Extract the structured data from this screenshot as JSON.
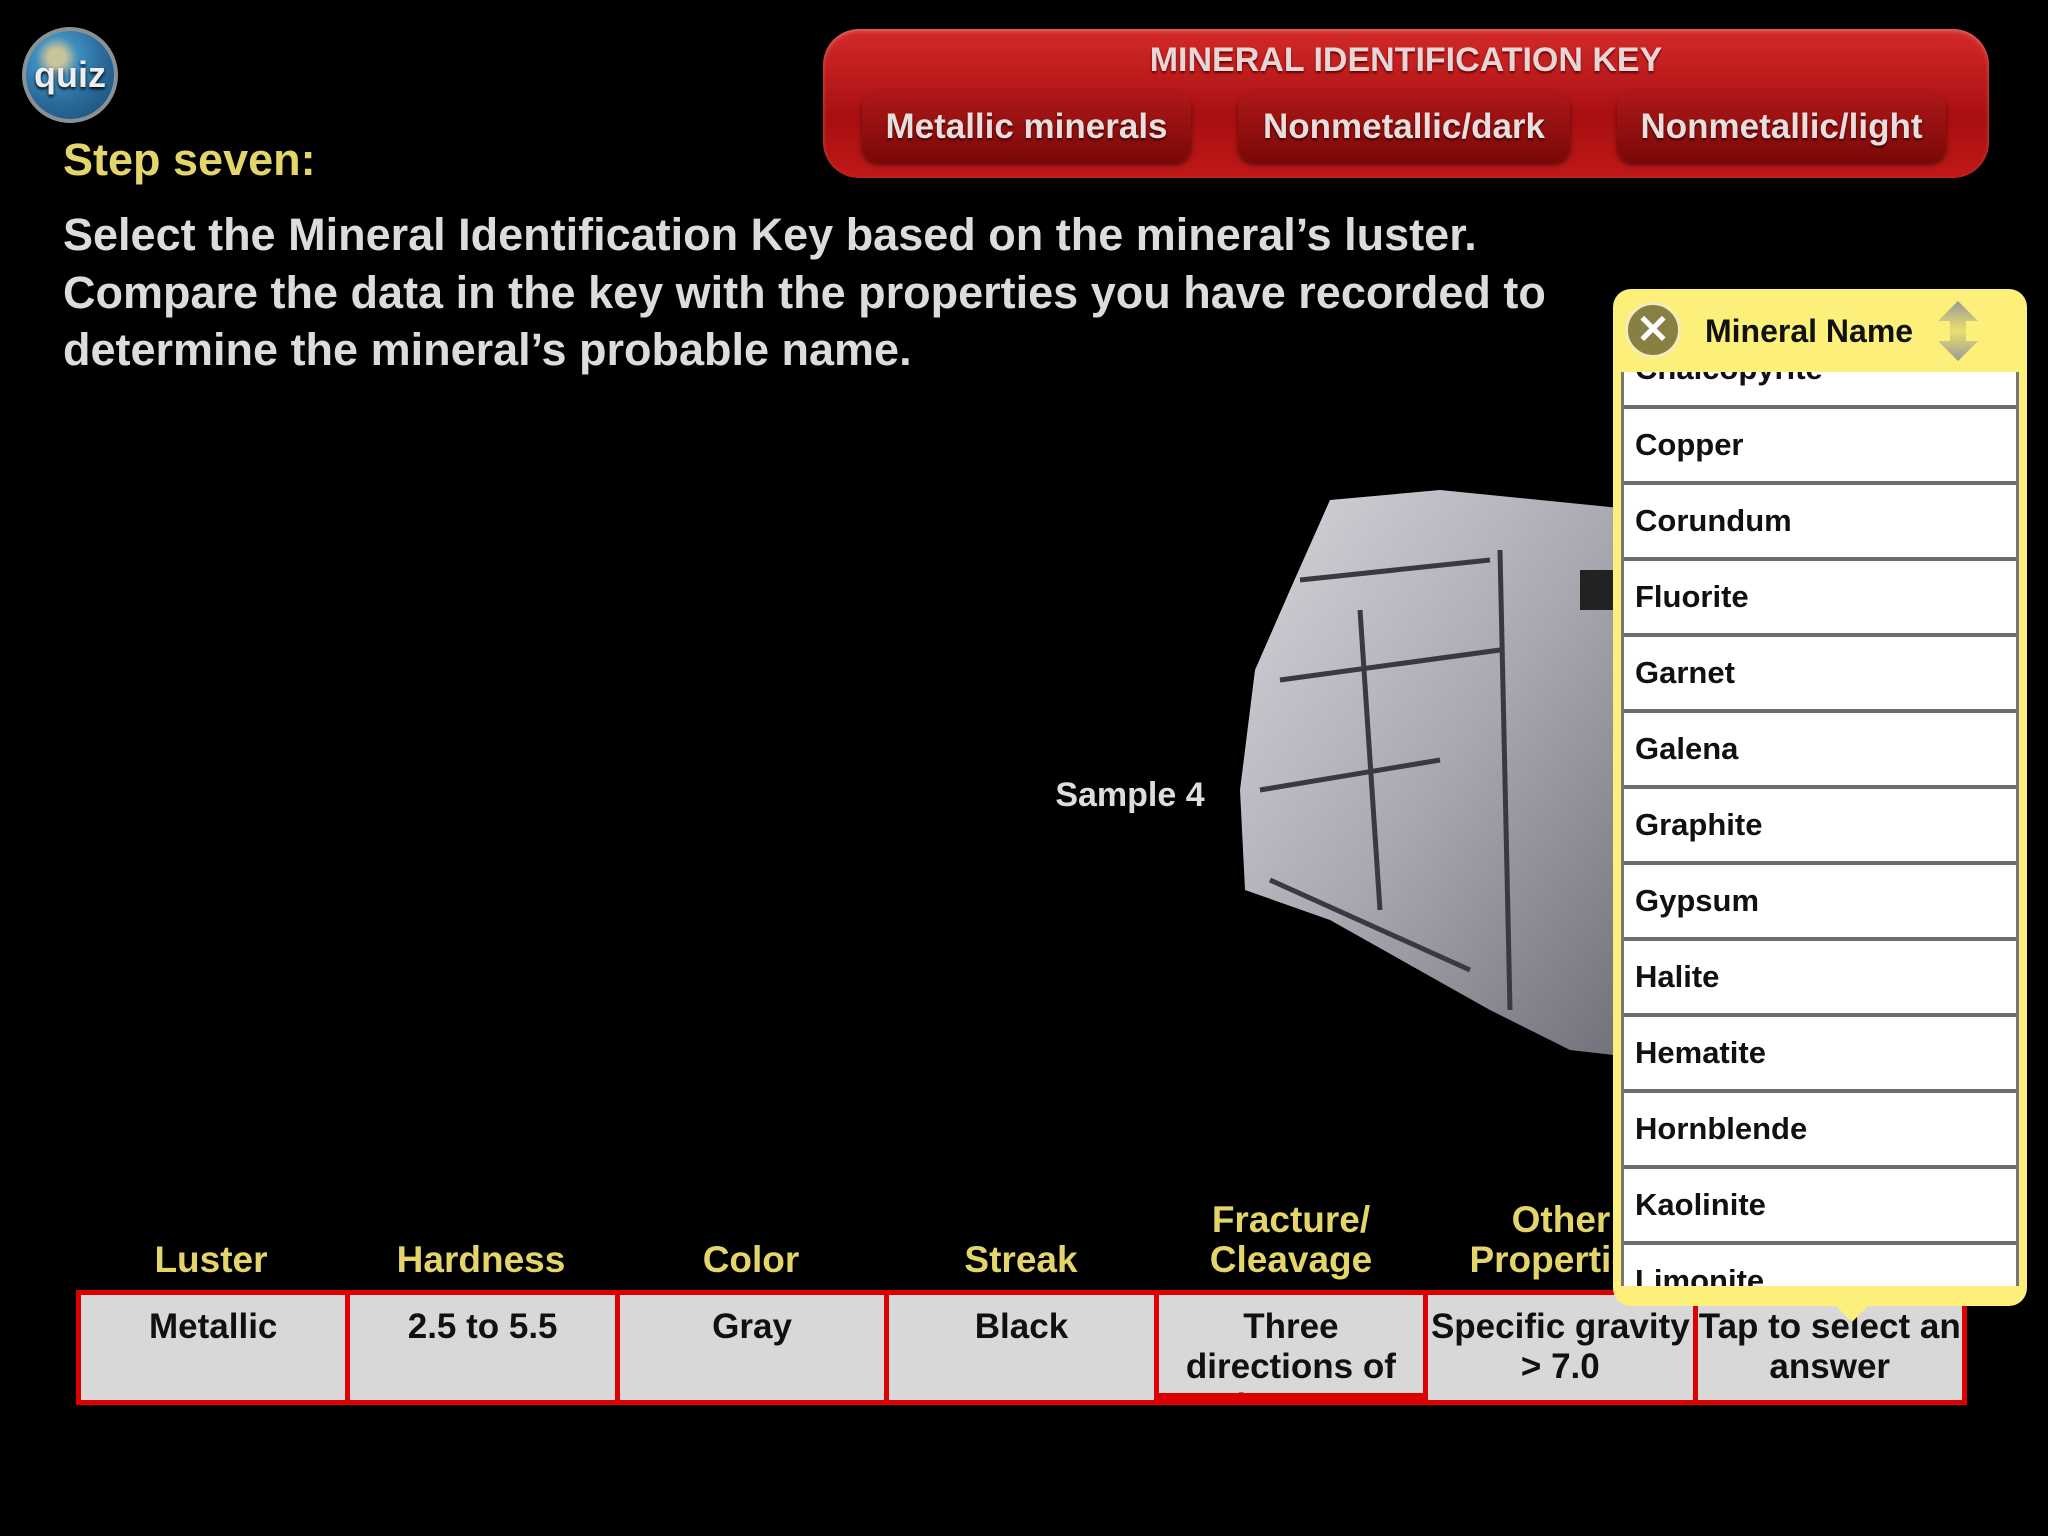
{
  "quiz_label": "quiz",
  "key": {
    "title": "MINERAL IDENTIFICATION KEY",
    "buttons": [
      "Metallic minerals",
      "Nonmetallic/dark",
      "Nonmetallic/light"
    ]
  },
  "step_title": "Step seven:",
  "instructions": "Select the Mineral Identification Key based on the mineral’s luster. Compare the data in the key with the properties you have recorded to determine the mineral’s probable name.",
  "sample_label": "Sample 4",
  "table": {
    "headers": [
      "Luster",
      "Hardness",
      "Color",
      "Streak",
      "Fracture/ Cleavage",
      "Other Properties",
      ""
    ],
    "values": [
      "Metallic",
      "2.5 to 5.5",
      "Gray",
      "Black",
      "Three directions of cleavage",
      "Specific gravity > 7.0",
      "Tap to select an answer"
    ]
  },
  "popup": {
    "title": "Mineral Name",
    "close_icon": "close-icon",
    "sort_icon": "up-down-arrow-icon",
    "items": [
      "Chalcopyrite",
      "Copper",
      "Corundum",
      "Fluorite",
      "Garnet",
      "Galena",
      "Graphite",
      "Gypsum",
      "Halite",
      "Hematite",
      "Hornblende",
      "Kaolinite",
      "Limonite"
    ]
  },
  "colors": {
    "accent_yellow": "#e3d56a",
    "banner_red": "#c01818",
    "popup_yellow": "#fdf07a"
  }
}
